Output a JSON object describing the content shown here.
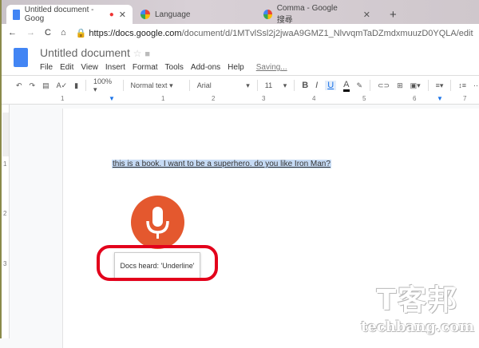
{
  "tabs": [
    {
      "label": "Untitled document - Goog"
    },
    {
      "label": "Language"
    },
    {
      "label": "Comma - Google 搜尋"
    }
  ],
  "new_tab": "+",
  "address": {
    "host": "https://docs.google.com",
    "path": "/document/d/1MTvlSsl2j2jwaA9GMZ1_NlvvqmTaDZmdxmuuzD0YQLA/edit"
  },
  "doc": {
    "title": "Untitled document",
    "save_status": "Saving..."
  },
  "menu": [
    "File",
    "Edit",
    "View",
    "Insert",
    "Format",
    "Tools",
    "Add-ons",
    "Help"
  ],
  "toolbar": {
    "zoom": "100%",
    "style": "Normal text",
    "font": "Arial",
    "size": "11",
    "bold": "B",
    "italic": "I",
    "underline": "U",
    "color": "A"
  },
  "ruler": [
    "1",
    "1",
    "2",
    "3",
    "4",
    "5",
    "6",
    "7"
  ],
  "vruler": [
    "1",
    "2",
    "3"
  ],
  "content": {
    "text": "this is a book. I want to be a superhero. do you like Iron Man?",
    "voice_popup": "Docs heard: 'Underline'"
  },
  "watermark": {
    "cn": "T客邦",
    "en": "techbang.com"
  }
}
